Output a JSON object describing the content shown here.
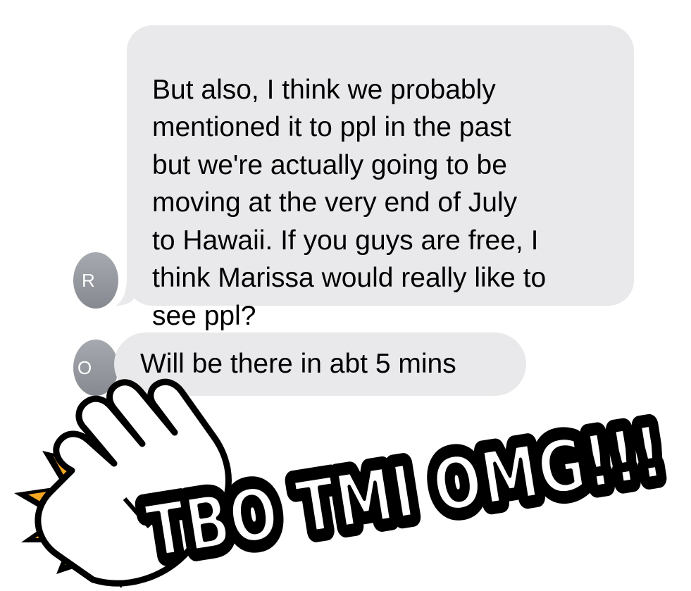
{
  "conversation": {
    "messages": [
      {
        "sender_initial": "R",
        "text": "But also, I think we probably\nmentioned it to ppl in the past\nbut we're actually going to be\nmoving at the very end of July\nto Hawaii. If you guys are free, I\nthink Marissa would really like to\nsee ppl?"
      },
      {
        "sender_initial": "O",
        "text": "Will be there in abt 5 mins"
      }
    ],
    "bubble_color": "#e9e9eb",
    "avatar_color": "#8e9096"
  },
  "sticker": {
    "text": "TBO TMI OMG!!!",
    "fill_color": "#ffffff",
    "outline_color": "#000000",
    "burst_colors": [
      "#f5c518",
      "#f5a623"
    ],
    "icon": "waving-hand-icon"
  }
}
